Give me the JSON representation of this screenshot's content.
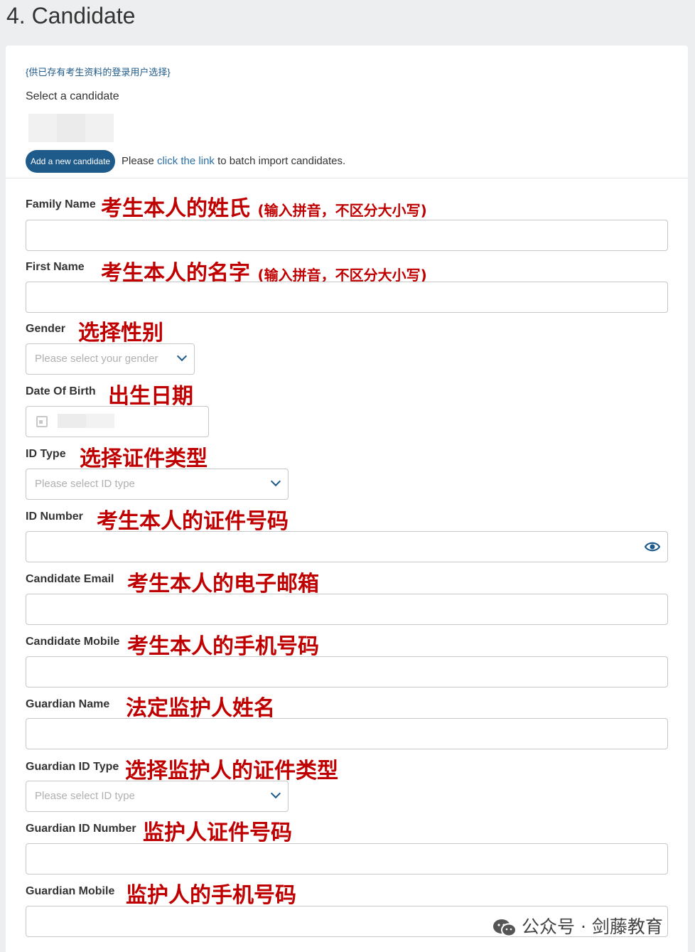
{
  "section": {
    "title": "4. Candidate"
  },
  "existing": {
    "hint": "{供已存有考生资料的登录用户选择}",
    "select_label": "Select a candidate",
    "add_button": "Add a new candidate",
    "batch_prefix": "Please ",
    "batch_link": "click the link",
    "batch_suffix": " to batch import candidates."
  },
  "fields": {
    "family_name": {
      "label": "Family Name",
      "note": "考生本人的姓氏",
      "note_small": "(输入拼音，不区分大小写)",
      "value": ""
    },
    "first_name": {
      "label": "First Name",
      "note": "考生本人的名字",
      "note_small": "(输入拼音，不区分大小写)",
      "value": ""
    },
    "gender": {
      "label": "Gender",
      "note": "选择性别",
      "placeholder": "Please select your gender"
    },
    "dob": {
      "label": "Date Of Birth",
      "note": "出生日期"
    },
    "id_type": {
      "label": "ID Type",
      "note": "选择证件类型",
      "placeholder": "Please select ID type"
    },
    "id_number": {
      "label": "ID Number",
      "note": "考生本人的证件号码",
      "value": ""
    },
    "email": {
      "label": "Candidate Email",
      "note": "考生本人的电子邮箱",
      "value": ""
    },
    "mobile": {
      "label": "Candidate Mobile",
      "note": "考生本人的手机号码",
      "value": ""
    },
    "guardian_name": {
      "label": "Guardian Name",
      "note": "法定监护人姓名",
      "value": ""
    },
    "guardian_id_type": {
      "label": "Guardian ID Type",
      "note": "选择监护人的证件类型",
      "placeholder": "Please select ID type"
    },
    "guardian_id_number": {
      "label": "Guardian ID Number",
      "note": "监护人证件号码",
      "value": ""
    },
    "guardian_mobile": {
      "label": "Guardian Mobile",
      "note": "监护人的手机号码",
      "value": ""
    }
  },
  "watermark": {
    "text": "公众号 · 剑藤教育",
    "icon": "wechat-icon"
  },
  "colors": {
    "accent": "#1e5a8a",
    "annotation": "#c00000",
    "background": "#eceeef"
  }
}
